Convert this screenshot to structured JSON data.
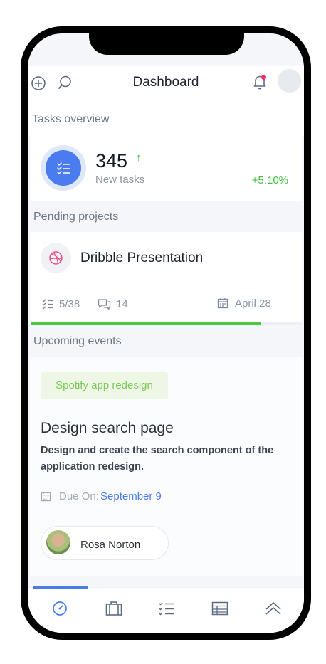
{
  "header": {
    "title": "Dashboard"
  },
  "tasks_overview": {
    "section_label": "Tasks overview",
    "count": "345",
    "trend_arrow": "↑",
    "caption": "New tasks",
    "change": "+5.10%"
  },
  "pending_projects": {
    "section_label": "Pending projects",
    "project_name": "Dribble Presentation",
    "tasks_ratio": "5/38",
    "comments": "14",
    "date": "April 28",
    "progress": 0.85
  },
  "upcoming_events": {
    "section_label": "Upcoming events",
    "tag": "Spotify app redesign",
    "event_title": "Design search page",
    "event_desc": "Design and create the search component of the application redesign.",
    "due_label": "Due On:",
    "due_date": "September 9",
    "assignee": "Rosa Norton"
  },
  "colors": {
    "accent": "#4a7cf0",
    "green": "#3fbf3f",
    "notification": "#f0306b",
    "progress": "#4cc93f"
  },
  "bottom_nav": {
    "items": [
      "dashboard-icon",
      "briefcase-icon",
      "tasks-icon",
      "table-icon",
      "chevron-up-icon"
    ],
    "active": "dashboard-icon"
  }
}
